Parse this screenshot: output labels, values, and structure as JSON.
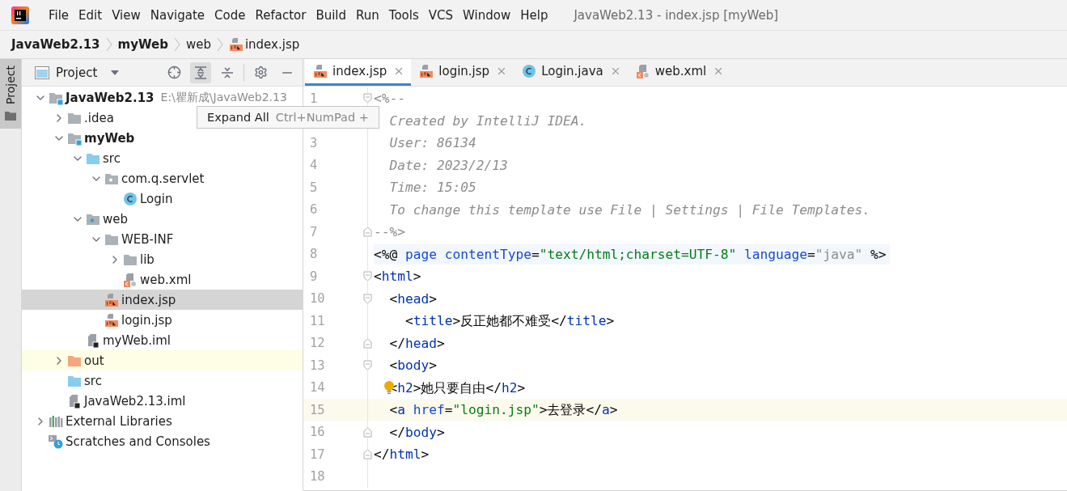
{
  "menu": [
    "File",
    "Edit",
    "View",
    "Navigate",
    "Code",
    "Refactor",
    "Build",
    "Run",
    "Tools",
    "VCS",
    "Window",
    "Help"
  ],
  "window": {
    "title": "JavaWeb2.13 - index.jsp [myWeb]"
  },
  "breadcrumbs": [
    {
      "label": "JavaWeb2.13",
      "kind": "module"
    },
    {
      "label": "myWeb",
      "kind": "module"
    },
    {
      "label": "web",
      "kind": "folder"
    },
    {
      "label": "index.jsp",
      "kind": "jsp"
    }
  ],
  "side_stripe": {
    "label": "Project",
    "selected": true
  },
  "project_panel": {
    "title": "Project",
    "tooltip": {
      "label": "Expand All",
      "shortcut": "Ctrl+NumPad +"
    },
    "tree": [
      {
        "label": "JavaWeb2.13",
        "hint": "E:\\瞿新成\\JavaWeb2.13",
        "kind": "module",
        "expanded": true,
        "selected": false,
        "highlighted": false,
        "children": [
          {
            "label": ".idea",
            "kind": "folder",
            "expanded": false,
            "selected": false,
            "highlighted": false
          },
          {
            "label": "myWeb",
            "kind": "module",
            "expanded": true,
            "selected": false,
            "highlighted": false,
            "children": [
              {
                "label": "src",
                "kind": "source",
                "expanded": true,
                "selected": false,
                "highlighted": false,
                "children": [
                  {
                    "label": "com.q.servlet",
                    "kind": "package",
                    "expanded": true,
                    "selected": false,
                    "highlighted": false,
                    "children": [
                      {
                        "label": "Login",
                        "kind": "class",
                        "selected": false,
                        "highlighted": false
                      }
                    ]
                  }
                ]
              },
              {
                "label": "web",
                "kind": "web",
                "expanded": true,
                "selected": false,
                "highlighted": false,
                "children": [
                  {
                    "label": "WEB-INF",
                    "kind": "folder",
                    "expanded": true,
                    "selected": false,
                    "highlighted": false,
                    "children": [
                      {
                        "label": "lib",
                        "kind": "folder",
                        "expanded": false,
                        "selected": false,
                        "highlighted": false
                      },
                      {
                        "label": "web.xml",
                        "kind": "xml",
                        "selected": false,
                        "highlighted": false
                      }
                    ]
                  },
                  {
                    "label": "index.jsp",
                    "kind": "jsp",
                    "selected": true,
                    "highlighted": false
                  },
                  {
                    "label": "login.jsp",
                    "kind": "jsp",
                    "selected": false,
                    "highlighted": false
                  }
                ]
              },
              {
                "label": "myWeb.iml",
                "kind": "iml",
                "selected": false,
                "highlighted": false
              }
            ]
          },
          {
            "label": "out",
            "kind": "output",
            "expanded": false,
            "selected": false,
            "highlighted": true
          },
          {
            "label": "src",
            "kind": "source",
            "selected": false,
            "highlighted": false
          },
          {
            "label": "JavaWeb2.13.iml",
            "kind": "iml",
            "selected": false,
            "highlighted": false
          }
        ]
      },
      {
        "label": "External Libraries",
        "kind": "libraries",
        "expanded": false,
        "selected": false,
        "highlighted": false
      },
      {
        "label": "Scratches and Consoles",
        "kind": "scratches",
        "selected": false,
        "highlighted": false
      }
    ]
  },
  "editor_tabs": [
    {
      "label": "index.jsp",
      "kind": "jsp",
      "selected": true
    },
    {
      "label": "login.jsp",
      "kind": "jsp",
      "selected": false
    },
    {
      "label": "Login.java",
      "kind": "class",
      "selected": false
    },
    {
      "label": "web.xml",
      "kind": "xml",
      "selected": false
    }
  ],
  "code_lines": [
    {
      "number": "1",
      "kind": "fold_start",
      "current": false,
      "tokens": [
        {
          "kind": "muted",
          "text": "<%--"
        }
      ]
    },
    {
      "kind": "plain",
      "current": false,
      "tokens": [
        {
          "kind": "comment",
          "text": "  Created by IntelliJ IDEA."
        }
      ]
    },
    {
      "number": "3",
      "kind": "plain",
      "current": false,
      "tokens": [
        {
          "kind": "comment",
          "text": "  User: 86134"
        }
      ]
    },
    {
      "number": "4",
      "kind": "plain",
      "current": false,
      "tokens": [
        {
          "kind": "comment",
          "text": "  Date: 2023/2/13"
        }
      ]
    },
    {
      "number": "5",
      "kind": "plain",
      "current": false,
      "tokens": [
        {
          "kind": "comment",
          "text": "  Time: 15:05"
        }
      ]
    },
    {
      "number": "6",
      "kind": "plain",
      "current": false,
      "tokens": [
        {
          "kind": "comment",
          "text": "  To change this template use File | Settings | File Templates."
        }
      ]
    },
    {
      "number": "7",
      "kind": "fold_end",
      "current": false,
      "tokens": [
        {
          "kind": "muted",
          "text": "--%>"
        }
      ]
    },
    {
      "number": "8",
      "kind": "directive",
      "current": false,
      "tokens": [
        {
          "kind": "plain",
          "text": "<%@ "
        },
        {
          "kind": "attr",
          "text": "page contentType"
        },
        {
          "kind": "plain",
          "text": "="
        },
        {
          "kind": "string",
          "text": "\"text/html;charset=UTF-8\""
        },
        {
          "kind": "attr",
          "text": " language"
        },
        {
          "kind": "plain",
          "text": "="
        },
        {
          "kind": "muted",
          "text": "\"java\""
        },
        {
          "kind": "plain",
          "text": " %>"
        }
      ]
    },
    {
      "number": "9",
      "kind": "fold_start",
      "current": false,
      "tokens": [
        {
          "kind": "plain",
          "text": "<"
        },
        {
          "kind": "tag",
          "text": "html"
        },
        {
          "kind": "plain",
          "text": ">"
        }
      ]
    },
    {
      "number": "10",
      "kind": "fold_start",
      "current": false,
      "tokens": [
        {
          "kind": "plain",
          "text": "  <"
        },
        {
          "kind": "tag",
          "text": "head"
        },
        {
          "kind": "plain",
          "text": ">"
        }
      ]
    },
    {
      "number": "11",
      "kind": "plain",
      "current": false,
      "tokens": [
        {
          "kind": "plain",
          "text": "    <"
        },
        {
          "kind": "tag",
          "text": "title"
        },
        {
          "kind": "plain",
          "text": ">反正她都不难受</"
        },
        {
          "kind": "tag",
          "text": "title"
        },
        {
          "kind": "plain",
          "text": ">"
        }
      ]
    },
    {
      "number": "12",
      "kind": "fold_end",
      "current": false,
      "tokens": [
        {
          "kind": "plain",
          "text": "  </"
        },
        {
          "kind": "tag",
          "text": "head"
        },
        {
          "kind": "plain",
          "text": ">"
        }
      ]
    },
    {
      "number": "13",
      "kind": "fold_start",
      "current": false,
      "tokens": [
        {
          "kind": "plain",
          "text": "  <"
        },
        {
          "kind": "tag",
          "text": "body"
        },
        {
          "kind": "plain",
          "text": ">"
        }
      ]
    },
    {
      "number": "14",
      "kind": "plain",
      "bulb": true,
      "current": false,
      "tokens": [
        {
          "kind": "plain",
          "text": "  <"
        },
        {
          "kind": "tag",
          "text": "h2"
        },
        {
          "kind": "plain",
          "text": ">她只要自由</"
        },
        {
          "kind": "tag",
          "text": "h2"
        },
        {
          "kind": "plain",
          "text": ">"
        }
      ]
    },
    {
      "number": "15",
      "kind": "plain",
      "current": true,
      "tokens": [
        {
          "kind": "plain",
          "text": "  <"
        },
        {
          "kind": "tag",
          "text": "a"
        },
        {
          "kind": "attr",
          "text": " href"
        },
        {
          "kind": "plain",
          "text": "="
        },
        {
          "kind": "string",
          "text": "\"login.jsp\""
        },
        {
          "kind": "plain",
          "text": ">去登录</"
        },
        {
          "kind": "tag",
          "text": "a"
        },
        {
          "kind": "plain",
          "text": ">"
        }
      ]
    },
    {
      "number": "16",
      "kind": "fold_end",
      "current": false,
      "tokens": [
        {
          "kind": "plain",
          "text": "  </"
        },
        {
          "kind": "tag",
          "text": "body"
        },
        {
          "kind": "plain",
          "text": ">"
        }
      ]
    },
    {
      "number": "17",
      "kind": "fold_end",
      "current": false,
      "tokens": [
        {
          "kind": "plain",
          "text": "</"
        },
        {
          "kind": "tag",
          "text": "html"
        },
        {
          "kind": "plain",
          "text": ">"
        }
      ]
    },
    {
      "number": "18",
      "kind": "plain",
      "current": false
    }
  ]
}
